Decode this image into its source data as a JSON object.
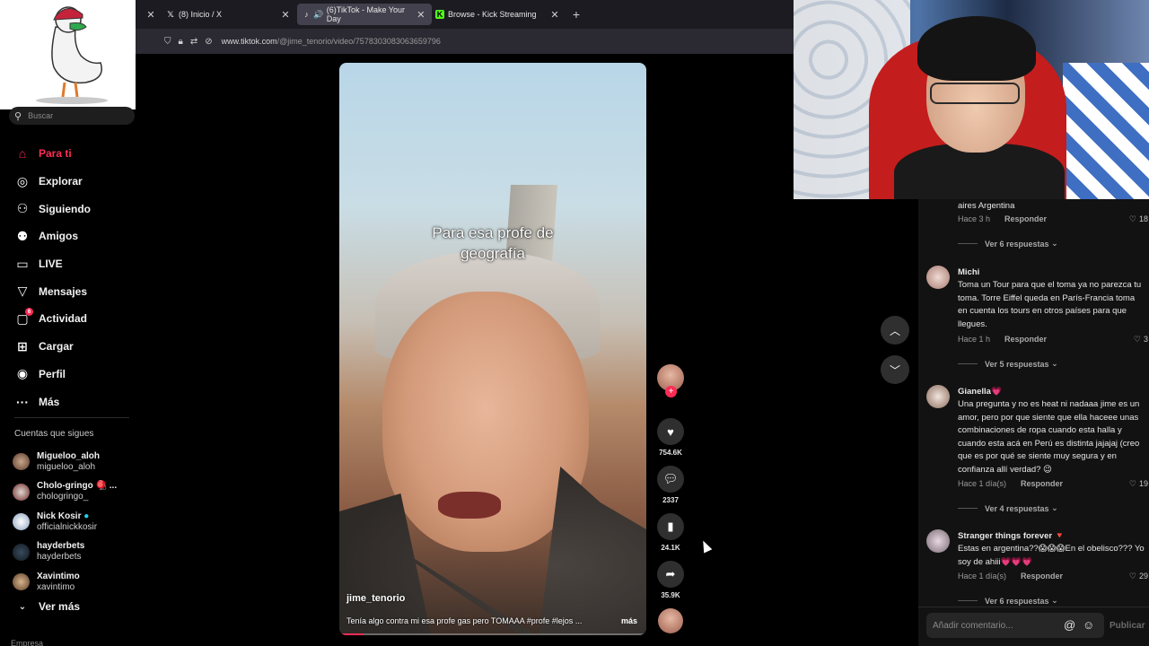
{
  "browser": {
    "tabs": [
      {
        "label": "(8) Inicio / X",
        "icon": "x-logo-icon"
      },
      {
        "label": "(6)TikTok - Make Your Day",
        "icon": "tiktok-icon"
      },
      {
        "label": "Browse - Kick Streaming",
        "icon": "kick-icon"
      }
    ],
    "url_host": "www.tiktok.com",
    "url_path": "/@jime_tenorio/video/7578303083063659796",
    "colors": {
      "accent": "#fe2c55",
      "tabbar": "#1c1b22"
    }
  },
  "sidebar": {
    "search_placeholder": "Buscar",
    "nav": [
      {
        "label": "Para ti",
        "icon": "home-icon",
        "active": true
      },
      {
        "label": "Explorar",
        "icon": "compass-icon"
      },
      {
        "label": "Siguiendo",
        "icon": "following-icon"
      },
      {
        "label": "Amigos",
        "icon": "friends-icon"
      },
      {
        "label": "LIVE",
        "icon": "live-icon"
      },
      {
        "label": "Mensajes",
        "icon": "messages-icon"
      },
      {
        "label": "Actividad",
        "icon": "activity-icon",
        "badge": "6"
      },
      {
        "label": "Cargar",
        "icon": "upload-icon"
      },
      {
        "label": "Perfil",
        "icon": "profile-icon"
      },
      {
        "label": "Más",
        "icon": "more-icon"
      }
    ],
    "following_title": "Cuentas que sigues",
    "following": [
      {
        "name": "Migueloo_aloh",
        "user": "migueloo_aloh"
      },
      {
        "name": "Cholo-gringo 🪀 ...",
        "user": "chologringo_"
      },
      {
        "name": "Nick Kosir",
        "user": "officialnickkosir",
        "verified": true
      },
      {
        "name": "hayderbets",
        "user": "hayderbets"
      },
      {
        "name": "Xavintimo",
        "user": "xavintimo"
      }
    ],
    "see_more": "Ver más",
    "company": "Empresa"
  },
  "video": {
    "caption_line1": "Para esa profe de",
    "caption_line2": "geografía",
    "username": "jime_tenorio",
    "description": "Tenía algo contra mi esa profe gas pero TOMAAA #profe #lejos ...",
    "more": "más",
    "progress": 0.08,
    "stats": {
      "likes": "754.6K",
      "comments": "2337",
      "saves": "24.1K",
      "shares": "35.9K"
    }
  },
  "comments": {
    "items": [
      {
        "name": "",
        "text_tail": "aires Argentina",
        "time": "Hace 3 h",
        "reply": "Responder",
        "likes": "18",
        "replies": "Ver 6 respuestas"
      },
      {
        "name": "Michi",
        "text": "Toma un Tour para que el toma ya no parezca tu toma. Torre Eiffel queda en París-Francia toma en cuenta los tours en otros países para que llegues.",
        "time": "Hace 1 h",
        "reply": "Responder",
        "likes": "3",
        "replies": "Ver 5 respuestas"
      },
      {
        "name": "Gianella💗",
        "text": "Una pregunta y no es heat ni nadaaa jime es un amor, pero por que siente que ella haceee unas combinaciones de ropa cuando esta halla y cuando esta acá en Perú es distinta jajajaj (creo que es por qué se siente muy segura y en confianza allí verdad? 😉",
        "time": "Hace 1 día(s)",
        "reply": "Responder",
        "likes": "19",
        "replies": "Ver 4 respuestas"
      },
      {
        "name": "Stranger things forever 🔻",
        "text": "Estas en argentina??😱😱😱En el obelisco??? Yo soy de ahiii💗💗💗",
        "time": "Hace 1 día(s)",
        "reply": "Responder",
        "likes": "29",
        "replies": "Ver 6 respuestas"
      }
    ],
    "input_placeholder": "Añadir comentario...",
    "publish": "Publicar"
  }
}
